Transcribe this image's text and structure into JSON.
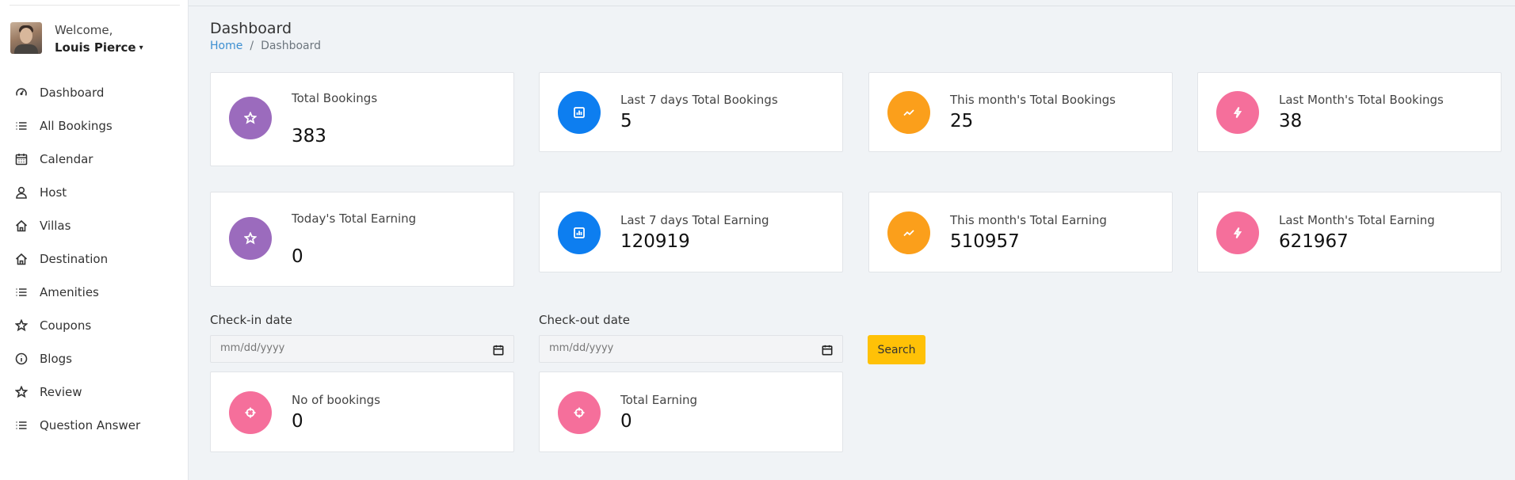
{
  "user": {
    "welcome": "Welcome,",
    "name": "Louis Pierce",
    "caret": "▾"
  },
  "sidebar": {
    "items": [
      {
        "label": "Dashboard",
        "icon": "gauge-icon"
      },
      {
        "label": "All Bookings",
        "icon": "list-icon"
      },
      {
        "label": "Calendar",
        "icon": "calendar-icon"
      },
      {
        "label": "Host",
        "icon": "user-icon"
      },
      {
        "label": "Villas",
        "icon": "home-icon"
      },
      {
        "label": "Destination",
        "icon": "home-icon"
      },
      {
        "label": "Amenities",
        "icon": "list-icon"
      },
      {
        "label": "Coupons",
        "icon": "star-icon"
      },
      {
        "label": "Blogs",
        "icon": "info-icon"
      },
      {
        "label": "Review",
        "icon": "star-icon"
      },
      {
        "label": "Question Answer",
        "icon": "list-icon"
      }
    ]
  },
  "header": {
    "title": "Dashboard",
    "breadcrumb": {
      "home": "Home",
      "separator": "/",
      "current": "Dashboard"
    }
  },
  "colors": {
    "purple": "#9b6bbd",
    "blue": "#0d7ef0",
    "orange": "#fb9f1b",
    "pink": "#f56f9b",
    "yellow": "#ffc107"
  },
  "stats": {
    "total_bookings": {
      "label": "Total Bookings",
      "value": "383",
      "icon": "star-icon"
    },
    "last7_bookings": {
      "label": "Last 7 days Total Bookings",
      "value": "5",
      "icon": "bar-chart-icon"
    },
    "month_bookings": {
      "label": "This month's Total Bookings",
      "value": "25",
      "icon": "trend-icon"
    },
    "lastmonth_bookings": {
      "label": "Last Month's Total Bookings",
      "value": "38",
      "icon": "bolt-icon"
    },
    "today_earning": {
      "label": "Today's Total Earning",
      "value": "0",
      "icon": "star-icon"
    },
    "last7_earning": {
      "label": "Last 7 days Total Earning",
      "value": "120919",
      "icon": "bar-chart-icon"
    },
    "month_earning": {
      "label": "This month's Total Earning",
      "value": "510957",
      "icon": "trend-icon"
    },
    "lastmonth_earning": {
      "label": "Last Month's Total Earning",
      "value": "621967",
      "icon": "bolt-icon"
    }
  },
  "filter": {
    "checkin_label": "Check-in date",
    "checkout_label": "Check-out date",
    "placeholder": "mm/dd/yyyy",
    "search_label": "Search"
  },
  "results": {
    "bookings": {
      "label": "No of bookings",
      "value": "0",
      "icon": "crosshair-icon"
    },
    "earning": {
      "label": "Total Earning",
      "value": "0",
      "icon": "crosshair-icon"
    }
  }
}
